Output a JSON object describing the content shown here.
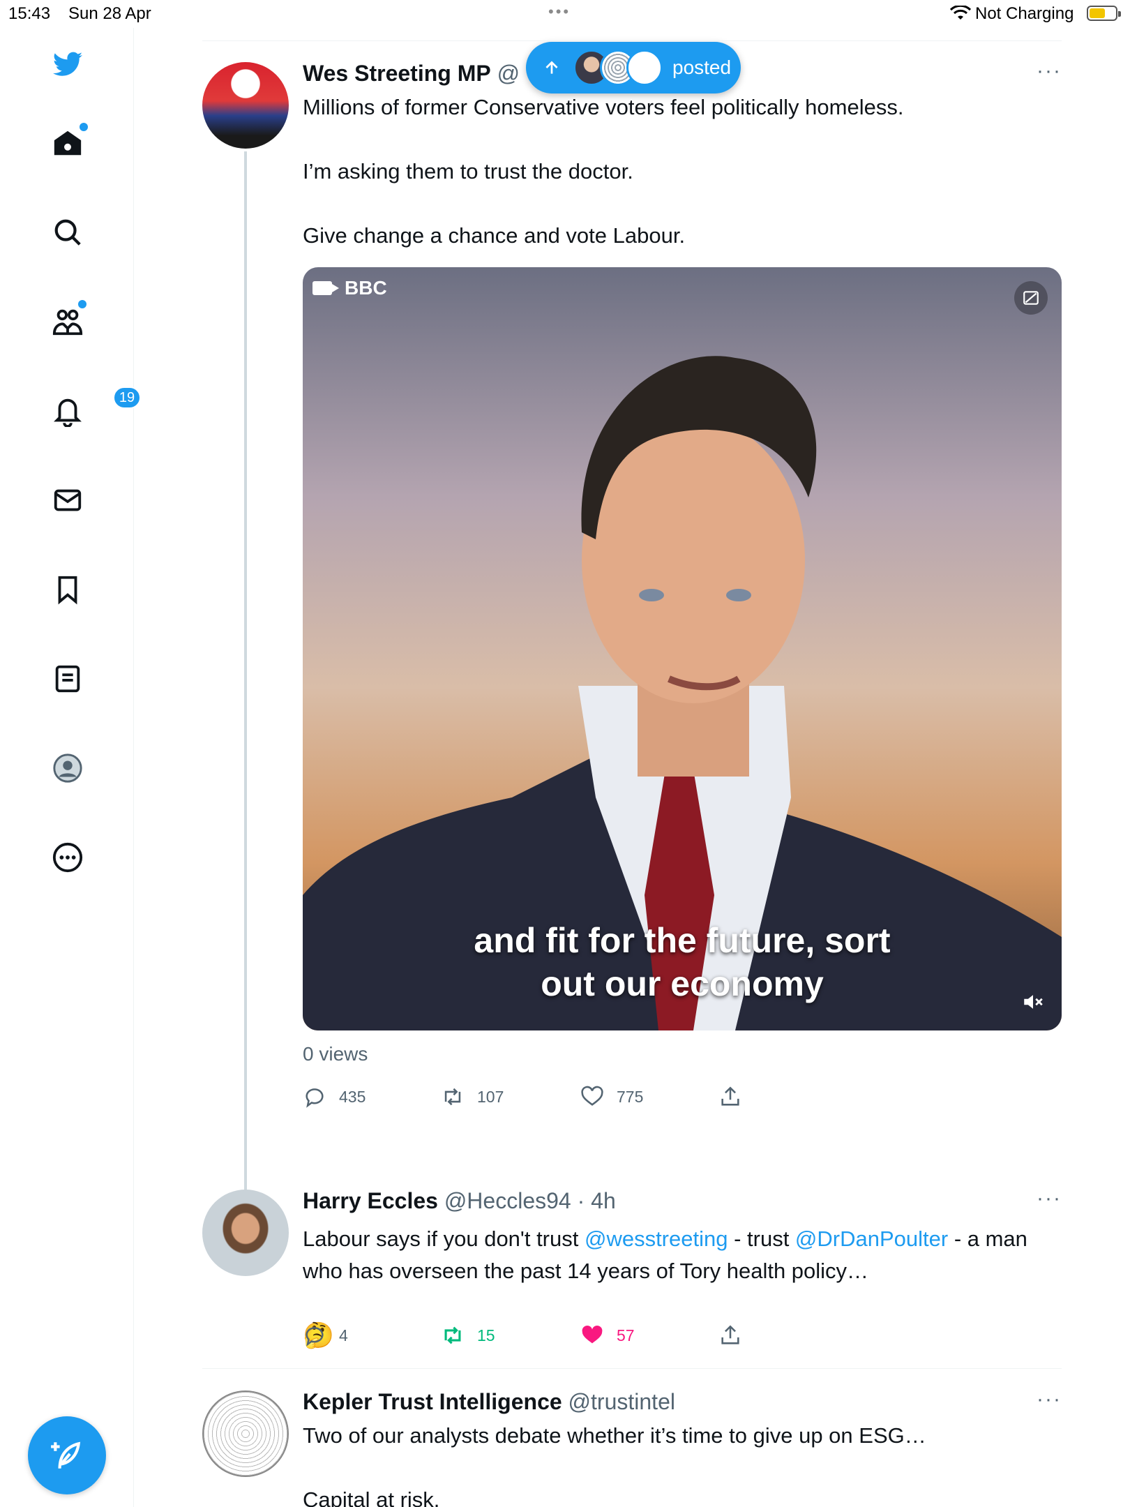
{
  "status_bar": {
    "time": "15:43",
    "date": "Sun 28 Apr",
    "more": "•••",
    "charging": "Not Charging",
    "battery_level": 0.6
  },
  "sidebar": {
    "items": [
      {
        "icon": "twitter-logo-icon"
      },
      {
        "icon": "home-icon",
        "has_dot": true
      },
      {
        "icon": "search-icon"
      },
      {
        "icon": "communities-icon",
        "has_dot": true
      },
      {
        "icon": "notifications-icon",
        "badge": "19"
      },
      {
        "icon": "messages-icon"
      },
      {
        "icon": "bookmarks-icon"
      },
      {
        "icon": "lists-icon"
      },
      {
        "icon": "profile-icon"
      },
      {
        "icon": "more-icon"
      }
    ],
    "compose_icon": "compose-tweet-icon"
  },
  "new_posts_pill": {
    "label": "posted",
    "arrow_icon": "arrow-up-icon"
  },
  "tweets": [
    {
      "name": "Wes Streeting MP",
      "handle": "@",
      "more": "···",
      "lines": [
        "Millions of former Conservative voters feel politically homeless.",
        "",
        "I’m asking them to trust the doctor.",
        "",
        "Give change a chance and vote Labour."
      ],
      "media": {
        "source": "BBC",
        "caption_line1": "and fit for the future, sort",
        "caption_line2": "out our economy"
      },
      "views": "0 views",
      "replies": "435",
      "retweets": "107",
      "likes": "775"
    },
    {
      "name": "Harry Eccles",
      "handle": "@Heccles94",
      "time": "· 4h",
      "more": "···",
      "text_parts": {
        "a": "Labour says if you don't trust ",
        "link1": "@wesstreeting",
        "b": " - trust ",
        "link2": "@DrDanPoulter",
        "c": " - a man who has overseen the past 14 years of Tory health policy…"
      },
      "emoji": "🤔",
      "replies": "4",
      "retweets": "15",
      "likes": "57"
    },
    {
      "name": "Kepler Trust Intelligence",
      "handle": "@trustintel",
      "more": "···",
      "lines": [
        "Two of our analysts debate whether it’s time to give up on ESG…",
        "",
        "Capital at risk."
      ]
    }
  ],
  "colors": {
    "accent": "#1d9bf0",
    "retweet_active": "#00ba7c",
    "like_active": "#f91880",
    "secondary_text": "#536471"
  }
}
